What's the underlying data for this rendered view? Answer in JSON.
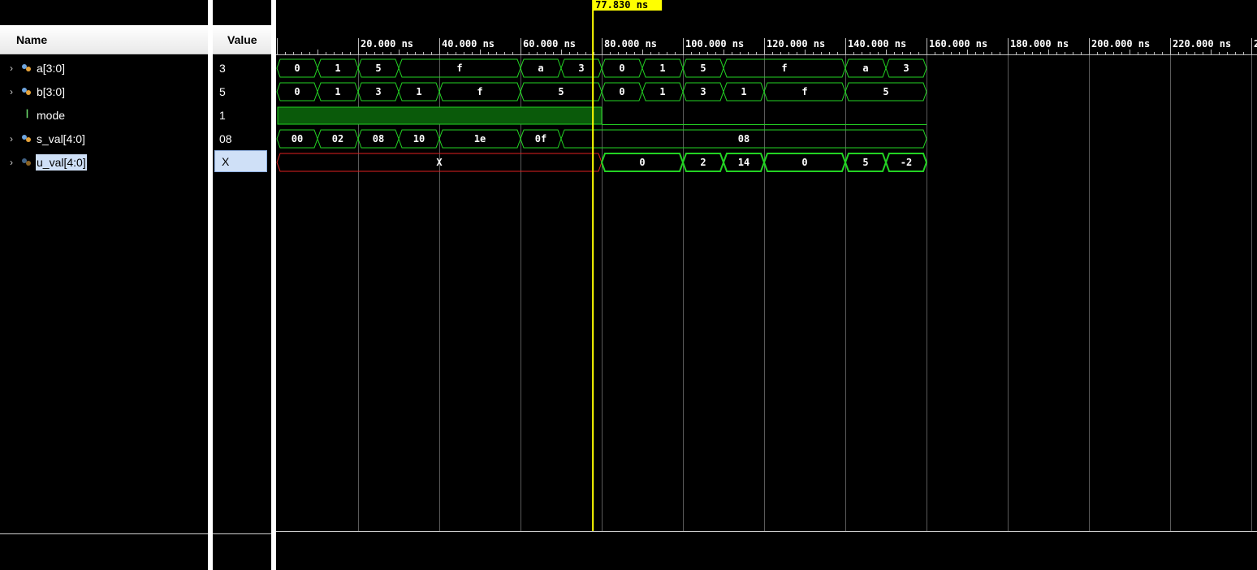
{
  "columns": {
    "name": "Name",
    "value": "Value"
  },
  "signals": [
    {
      "name": "a[3:0]",
      "value": "3",
      "kind": "bus",
      "expandable": true
    },
    {
      "name": "b[3:0]",
      "value": "5",
      "kind": "bus",
      "expandable": true
    },
    {
      "name": "mode",
      "value": "1",
      "kind": "bit",
      "expandable": false
    },
    {
      "name": "s_val[4:0]",
      "value": "08",
      "kind": "bus",
      "expandable": true
    },
    {
      "name": "u_val[4:0]",
      "value": "X",
      "kind": "bus",
      "expandable": true,
      "selected": true
    }
  ],
  "cursor": {
    "time_ns": 77.83,
    "label": "77.830 ns"
  },
  "timeline": {
    "ticks": [
      {
        "t": 20,
        "label": "20.000 ns"
      },
      {
        "t": 40,
        "label": "40.000 ns"
      },
      {
        "t": 60,
        "label": "60.000 ns"
      },
      {
        "t": 80,
        "label": "80.000 ns"
      },
      {
        "t": 100,
        "label": "100.000 ns"
      },
      {
        "t": 120,
        "label": "120.000 ns"
      },
      {
        "t": 140,
        "label": "140.000 ns"
      },
      {
        "t": 160,
        "label": "160.000 ns"
      },
      {
        "t": 180,
        "label": "180.000 ns"
      },
      {
        "t": 200,
        "label": "200.000 ns"
      },
      {
        "t": 220,
        "label": "220.000 ns"
      },
      {
        "t": 240,
        "label": "2"
      }
    ]
  },
  "waves": [
    {
      "signal": "a[3:0]",
      "color": "#23d323",
      "segments": [
        {
          "start": 0,
          "end": 10,
          "value": "0"
        },
        {
          "start": 10,
          "end": 20,
          "value": "1"
        },
        {
          "start": 20,
          "end": 30,
          "value": "5"
        },
        {
          "start": 30,
          "end": 60,
          "value": "f"
        },
        {
          "start": 60,
          "end": 70,
          "value": "a"
        },
        {
          "start": 70,
          "end": 80,
          "value": "3"
        },
        {
          "start": 80,
          "end": 90,
          "value": "0"
        },
        {
          "start": 90,
          "end": 100,
          "value": "1"
        },
        {
          "start": 100,
          "end": 110,
          "value": "5"
        },
        {
          "start": 110,
          "end": 140,
          "value": "f"
        },
        {
          "start": 140,
          "end": 150,
          "value": "a"
        },
        {
          "start": 150,
          "end": 160,
          "value": "3"
        }
      ]
    },
    {
      "signal": "b[3:0]",
      "color": "#23d323",
      "segments": [
        {
          "start": 0,
          "end": 10,
          "value": "0"
        },
        {
          "start": 10,
          "end": 20,
          "value": "1"
        },
        {
          "start": 20,
          "end": 30,
          "value": "3"
        },
        {
          "start": 30,
          "end": 40,
          "value": "1"
        },
        {
          "start": 40,
          "end": 60,
          "value": "f"
        },
        {
          "start": 60,
          "end": 80,
          "value": "5"
        },
        {
          "start": 80,
          "end": 90,
          "value": "0"
        },
        {
          "start": 90,
          "end": 100,
          "value": "1"
        },
        {
          "start": 100,
          "end": 110,
          "value": "3"
        },
        {
          "start": 110,
          "end": 120,
          "value": "1"
        },
        {
          "start": 120,
          "end": 140,
          "value": "f"
        },
        {
          "start": 140,
          "end": 160,
          "value": "5"
        }
      ]
    },
    {
      "signal": "mode",
      "color": "#23d323",
      "bit_segments": [
        {
          "start": 0,
          "end": 80,
          "level": 1
        },
        {
          "start": 80,
          "end": 160,
          "level": 0
        }
      ]
    },
    {
      "signal": "s_val[4:0]",
      "color": "#23d323",
      "segments": [
        {
          "start": 0,
          "end": 10,
          "value": "00"
        },
        {
          "start": 10,
          "end": 20,
          "value": "02"
        },
        {
          "start": 20,
          "end": 30,
          "value": "08"
        },
        {
          "start": 30,
          "end": 40,
          "value": "10"
        },
        {
          "start": 40,
          "end": 60,
          "value": "1e"
        },
        {
          "start": 60,
          "end": 70,
          "value": "0f"
        },
        {
          "start": 70,
          "end": 160,
          "value": "08"
        }
      ]
    },
    {
      "signal": "u_val[4:0]",
      "color": "#23d323",
      "segments": [
        {
          "start": 0,
          "end": 80,
          "value": "X",
          "color": "#e02020"
        },
        {
          "start": 80,
          "end": 100,
          "value": "0"
        },
        {
          "start": 100,
          "end": 110,
          "value": "2"
        },
        {
          "start": 110,
          "end": 120,
          "value": "14"
        },
        {
          "start": 120,
          "end": 140,
          "value": "0"
        },
        {
          "start": 140,
          "end": 150,
          "value": "5"
        },
        {
          "start": 150,
          "end": 160,
          "value": "-2"
        }
      ]
    }
  ],
  "colors": {
    "cursor": "#ffff00",
    "grid": "#5a5a5a",
    "wave": "#23d323",
    "x_state": "#e02020"
  }
}
